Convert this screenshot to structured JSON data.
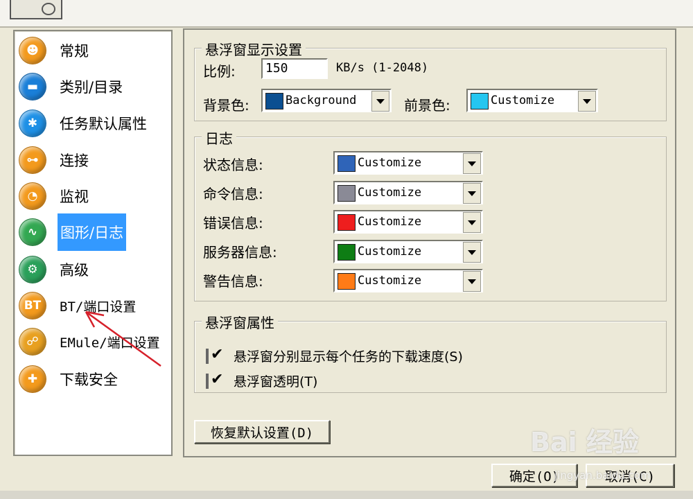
{
  "sidebar": {
    "items": [
      {
        "label": "常规",
        "color": "#f39a1d",
        "glyph": "☻"
      },
      {
        "label": "类别/目录",
        "color": "#1a7fd8",
        "glyph": "▬"
      },
      {
        "label": "任务默认属性",
        "color": "#1e90e6",
        "glyph": "✱"
      },
      {
        "label": "连接",
        "color": "#f39a1d",
        "glyph": "⊶"
      },
      {
        "label": "监视",
        "color": "#f39a1d",
        "glyph": "◔"
      },
      {
        "label": "图形/日志",
        "color": "#33a852",
        "glyph": "∿"
      },
      {
        "label": "高级",
        "color": "#2aa05a",
        "glyph": "⚙"
      },
      {
        "label": "BT/端口设置",
        "color": "#f39a1d",
        "glyph": "BT"
      },
      {
        "label": "EMule/端口设置",
        "color": "#e8a020",
        "glyph": "☍"
      },
      {
        "label": "下载安全",
        "color": "#f39a1d",
        "glyph": "✚"
      }
    ]
  },
  "float_display": {
    "title": "悬浮窗显示设置",
    "ratio_label": "比例:",
    "ratio_value": "150",
    "ratio_unit": "KB/s (1-2048)",
    "bg_label": "背景色:",
    "bg_value": "Background",
    "bg_color": "#0b4f91",
    "fg_label": "前景色:",
    "fg_value": "Customize",
    "fg_color": "#25c6f0"
  },
  "log": {
    "title": "日志",
    "rows": [
      {
        "label": "状态信息:",
        "value": "Customize",
        "color": "#2f64b8"
      },
      {
        "label": "命令信息:",
        "value": "Customize",
        "color": "#8a8a96"
      },
      {
        "label": "错误信息:",
        "value": "Customize",
        "color": "#ee1e1e"
      },
      {
        "label": "服务器信息:",
        "value": "Customize",
        "color": "#0e7d14"
      },
      {
        "label": "警告信息:",
        "value": "Customize",
        "color": "#ff7b17"
      }
    ]
  },
  "float_props": {
    "title": "悬浮窗属性",
    "options": [
      {
        "label": "悬浮窗分别显示每个任务的下载速度(S)"
      },
      {
        "label": "悬浮窗透明(T)"
      }
    ]
  },
  "buttons": {
    "restore": "恢复默认设置(D)",
    "ok": "确定(O)",
    "cancel": "取消(C)"
  },
  "watermark": {
    "brand": "Bai 经验",
    "url": "jingyan.baidu.com"
  }
}
